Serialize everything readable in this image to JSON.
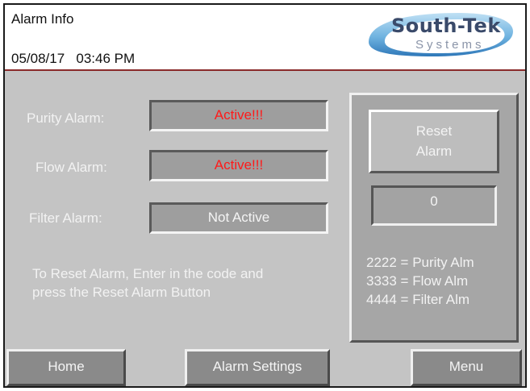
{
  "header": {
    "title": "Alarm Info",
    "date": "05/08/17",
    "time": "03:46 PM",
    "logo": {
      "name": "South-Tek",
      "subtitle": "Systems"
    }
  },
  "alarms": [
    {
      "label": "Purity Alarm:",
      "status": "Active!!!"
    },
    {
      "label": "Flow Alarm:",
      "status": "Active!!!"
    },
    {
      "label": "Filter Alarm:",
      "status": "Not Active"
    }
  ],
  "note": {
    "line1": "To Reset Alarm, Enter in the code and",
    "line2": "press the Reset Alarm Button"
  },
  "reset": {
    "button_line1": "Reset",
    "button_line2": "Alarm",
    "code_value": "0",
    "codes": [
      "2222 = Purity Alm",
      "3333 = Flow Alm",
      "4444 = Filter Alm"
    ]
  },
  "nav": {
    "home": "Home",
    "alarm_settings": "Alarm Settings",
    "menu": "Menu"
  },
  "colors": {
    "active_status": "#ff1a1a",
    "background": "#c4c4c4",
    "header_border": "#8a2a2a",
    "logo_text": "#3a4a6a"
  }
}
